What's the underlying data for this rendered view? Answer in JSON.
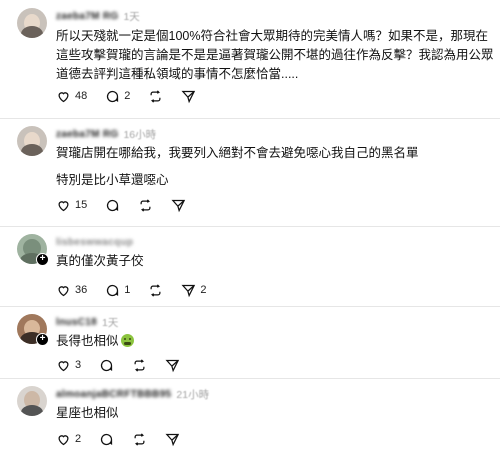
{
  "comments": [
    {
      "username": "zaeba7M RG",
      "timestamp": "1天",
      "body": [
        "所以天殘就一定是個100%符合社會大眾期待的完美情人嗎？如果不是，那現在這些攻擊賀瓏的言論是不是是逼著賀瓏公開不堪的過往作為反擊？我認為用公眾道德去評判這種私領域的事情不怎麼恰當....."
      ],
      "likes": "48",
      "replies": "2",
      "reposts": "",
      "shares": ""
    },
    {
      "username": "zaeba7M RG",
      "timestamp": "16小時",
      "body": [
        "賀瓏店開在哪給我，我要列入絕對不會去避免噁心我自己的黑名單",
        "特別是比小草還噁心"
      ],
      "likes": "15",
      "replies": "",
      "reposts": "",
      "shares": ""
    },
    {
      "username": "lisbeswwacqup",
      "timestamp": "",
      "body": [
        "真的僅次黃子佼"
      ],
      "likes": "36",
      "replies": "1",
      "reposts": "",
      "shares": "2"
    },
    {
      "username": "lnusC18",
      "timestamp": "1天",
      "body": [
        "長得也相似"
      ],
      "likes": "3",
      "replies": "",
      "reposts": "",
      "shares": ""
    },
    {
      "username": "almoanjaBCRFTBBB95",
      "timestamp": "21小時",
      "body": [
        "星座也相似"
      ],
      "likes": "2",
      "replies": "",
      "reposts": "",
      "shares": ""
    }
  ],
  "icons": {
    "like": "heart-icon",
    "reply": "comment-bubble-icon",
    "repost": "repost-icon",
    "share": "send-icon",
    "follow": "plus-icon",
    "emoji": "nauseated-face-emoji"
  },
  "colors": {
    "text": "#101010",
    "muted": "#a5a5a5",
    "divider": "#e6e6e6",
    "badge": "#000000"
  }
}
